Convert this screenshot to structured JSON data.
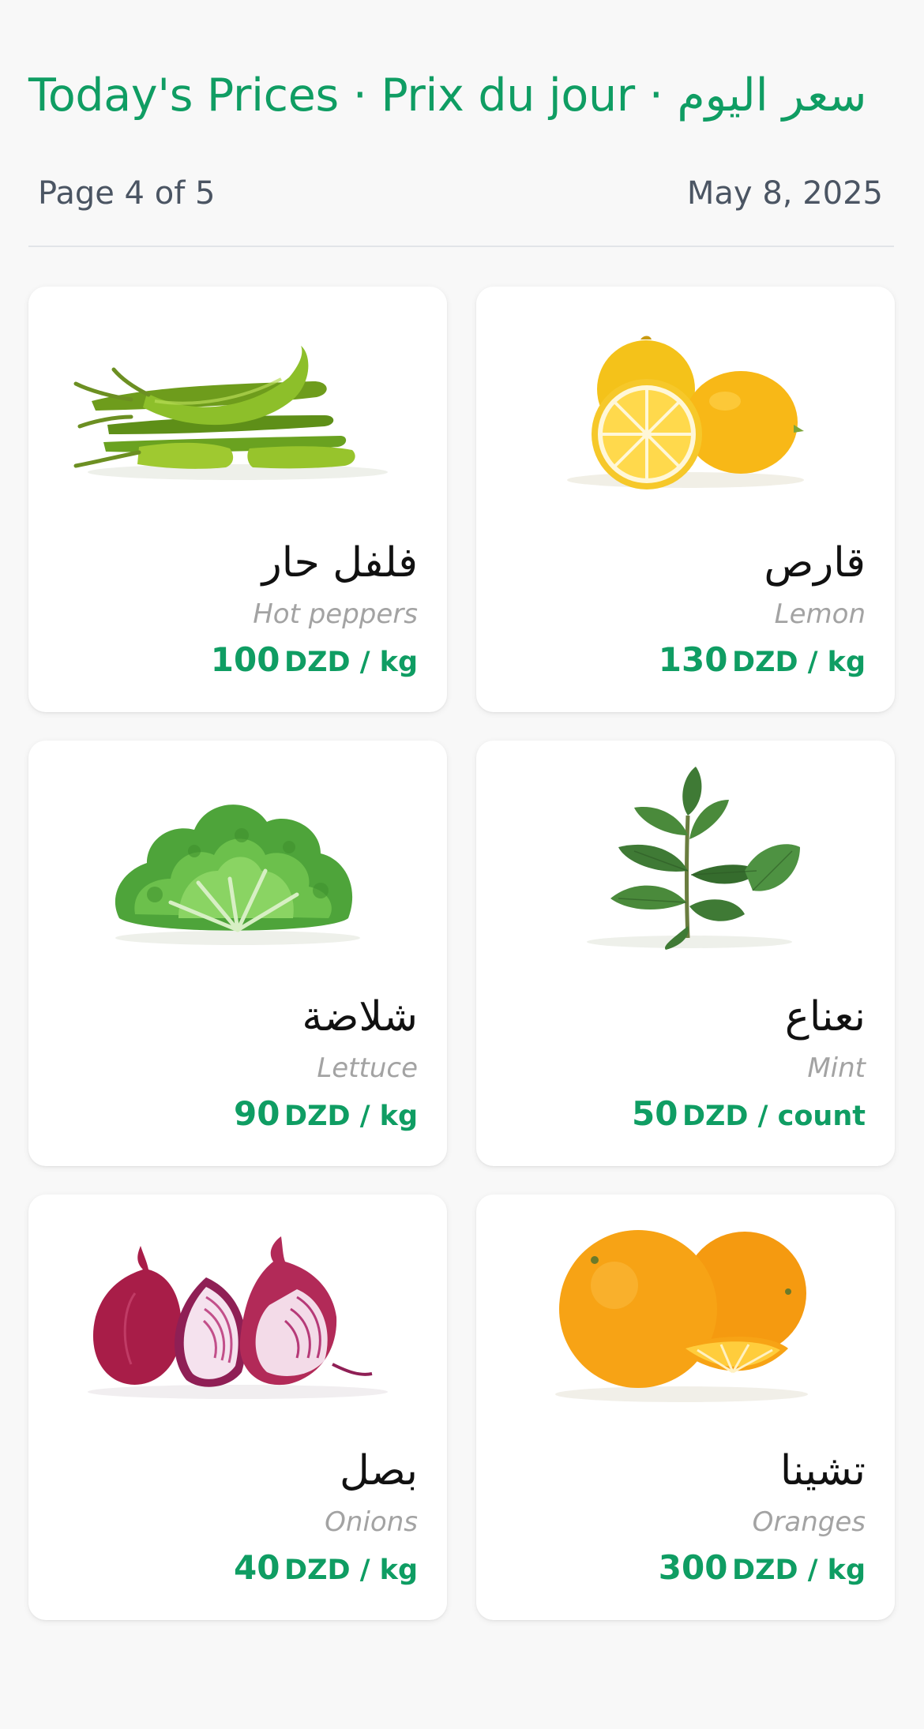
{
  "header": {
    "title": "Today's Prices · Prix du jour · سعر اليوم",
    "page_label": "Page 4 of 5",
    "date": "May 8, 2025"
  },
  "colors": {
    "accent": "#0f9d63",
    "background": "#f8f8f8",
    "card": "#ffffff",
    "muted": "#a3a3a3",
    "meta": "#4b5563"
  },
  "products": [
    {
      "name_ar": "فلفل حار",
      "name_en": "Hot peppers",
      "price": "100",
      "unit": "DZD / kg",
      "image": "hot-peppers-image"
    },
    {
      "name_ar": "قارص",
      "name_en": "Lemon",
      "price": "130",
      "unit": "DZD / kg",
      "image": "lemon-image"
    },
    {
      "name_ar": "شلاضة",
      "name_en": "Lettuce",
      "price": "90",
      "unit": "DZD / kg",
      "image": "lettuce-image"
    },
    {
      "name_ar": "نعناع",
      "name_en": "Mint",
      "price": "50",
      "unit": "DZD / count",
      "image": "mint-image"
    },
    {
      "name_ar": "بصل",
      "name_en": "Onions",
      "price": "40",
      "unit": "DZD / kg",
      "image": "onions-image"
    },
    {
      "name_ar": "تشينا",
      "name_en": "Oranges",
      "price": "300",
      "unit": "DZD / kg",
      "image": "oranges-image"
    }
  ]
}
